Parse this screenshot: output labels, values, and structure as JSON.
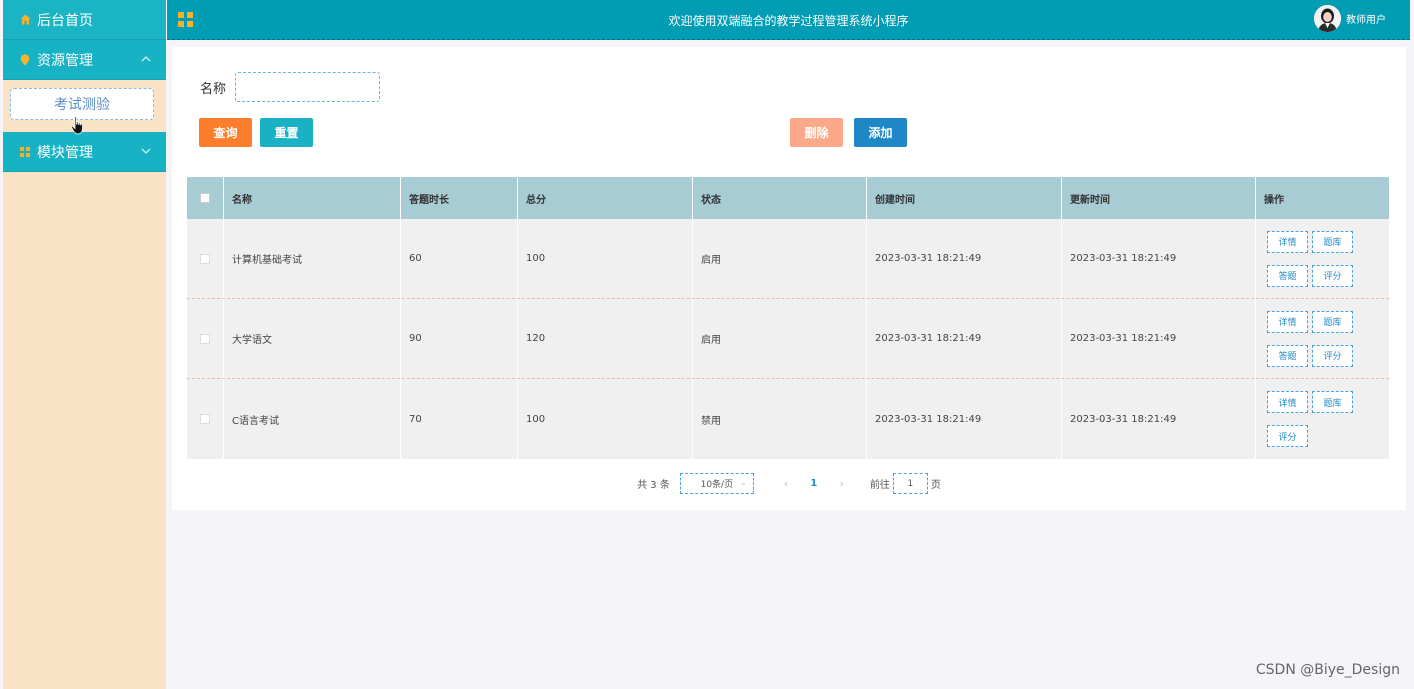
{
  "sidebar": {
    "home_label": "后台首页",
    "resource_label": "资源管理",
    "exam_label": "考试测验",
    "module_label": "模块管理"
  },
  "header": {
    "title": "欢迎使用双端融合的教学过程管理系统小程序",
    "user": "教师用户"
  },
  "search": {
    "label": "名称",
    "value": "",
    "placeholder": ""
  },
  "buttons": {
    "query": "查询",
    "reset": "重置",
    "delete": "删除",
    "add": "添加"
  },
  "table": {
    "columns": [
      "名称",
      "答题时长",
      "总分",
      "状态",
      "创建时间",
      "更新时间",
      "操作"
    ],
    "rows": [
      {
        "name": "计算机基础考试",
        "duration": "60",
        "score": "100",
        "status": "启用",
        "created": "2023-03-31 18:21:49",
        "updated": "2023-03-31 18:21:49",
        "ops": [
          "详情",
          "题库",
          "答题",
          "评分"
        ]
      },
      {
        "name": "大学语文",
        "duration": "90",
        "score": "120",
        "status": "启用",
        "created": "2023-03-31 18:21:49",
        "updated": "2023-03-31 18:21:49",
        "ops": [
          "详情",
          "题库",
          "答题",
          "评分"
        ]
      },
      {
        "name": "C语言考试",
        "duration": "70",
        "score": "100",
        "status": "禁用",
        "created": "2023-03-31 18:21:49",
        "updated": "2023-03-31 18:21:49",
        "ops": [
          "详情",
          "题库",
          "评分"
        ]
      }
    ]
  },
  "pager": {
    "total": "共 3 条",
    "page_size": "10条/页",
    "current": "1",
    "goto_prefix": "前往",
    "goto_value": "1",
    "goto_suffix": "页",
    "prev": "‹",
    "next": "›"
  },
  "watermark": "CSDN @Biye_Design",
  "colors": {
    "header": "#009db4",
    "sidebar_item": "#17b3c4",
    "sidebar_bg": "#fae3c4",
    "query": "#fd7d2c",
    "reset": "#1ab1c5",
    "delete": "#fba98a",
    "add": "#1e88c7",
    "table_head": "#a7ccd4"
  },
  "icons": {
    "home": "home-icon",
    "resource": "location-pin-icon",
    "module": "grid-icon",
    "menu_toggle": "grid-icon",
    "arrow_up": "chevron-up-icon",
    "arrow_down": "chevron-down-icon"
  }
}
